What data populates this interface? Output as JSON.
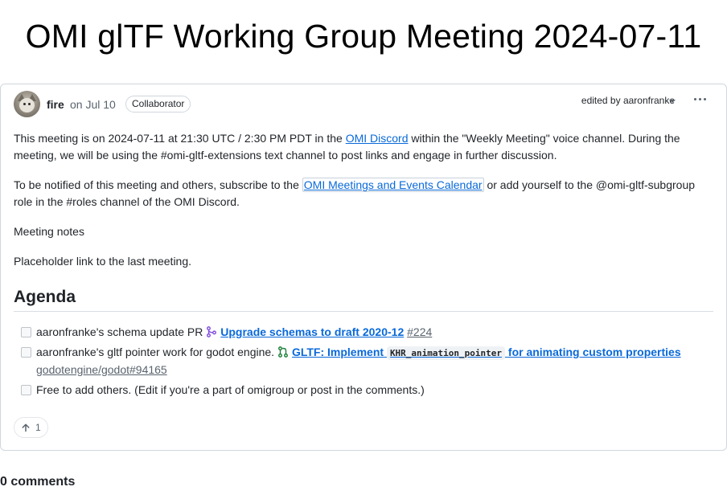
{
  "page": {
    "title": "OMI glTF Working Group Meeting 2024-07-11"
  },
  "issue": {
    "author": "fire",
    "date": "on Jul 10",
    "role_badge": "Collaborator",
    "edited_label": "edited by aaronfranke",
    "paragraphs": {
      "p1_before": "This meeting is on 2024-07-11 at 21:30 UTC / 2:30 PM PDT in the ",
      "p1_link": "OMI Discord",
      "p1_after": " within the \"Weekly Meeting\" voice channel. During the meeting, we will be using the #omi-gltf-extensions text channel to post links and engage in further discussion.",
      "p2_before": "To be notified of this meeting and others, subscribe to the ",
      "p2_link": "OMI Meetings and Events Calendar",
      "p2_after": " or add yourself to the @omi-gltf-subgroup role in the #roles channel of the OMI Discord.",
      "p3": "Meeting notes",
      "p4": "Placeholder link to the last meeting."
    },
    "agenda": {
      "heading": "Agenda",
      "items": [
        {
          "text": "aaronfranke's schema update PR ",
          "pr_title": "Upgrade schemas to draft 2020-12",
          "pr_ref": "#224",
          "icon": "pull-request-merged-icon",
          "checked": false
        },
        {
          "text": "aaronfranke's gltf pointer work for godot engine. ",
          "pr_title_start": "GLTF: Implement",
          "pr_code": "KHR_animation_pointer",
          "pr_title_end": "for animating custom properties",
          "pr_ref": "godotengine/godot#94165",
          "icon": "pull-request-open-icon",
          "checked": false
        },
        {
          "text": "Free to add others. (Edit if you're a part of omigroup or post in the comments.)",
          "checked": false
        }
      ]
    },
    "reaction": {
      "icon": "arrow-up-icon",
      "count": "1"
    }
  },
  "comments": {
    "count_label": "0 comments"
  },
  "colors": {
    "link": "#0969da",
    "merged_purple": "#8250df",
    "open_green": "#1a7f37",
    "border": "#d0d7de"
  }
}
